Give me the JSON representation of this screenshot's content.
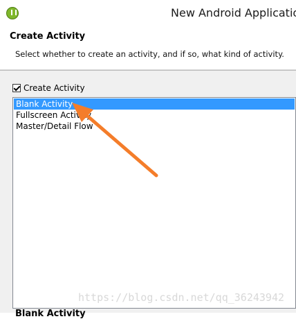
{
  "window": {
    "title": "New Android Application",
    "app_icon": "android-adt-icon"
  },
  "header": {
    "title": "Create Activity",
    "description": "Select whether to create an activity, and if so, what kind of activity."
  },
  "create_activity_checkbox": {
    "label": "Create Activity",
    "checked": true
  },
  "activity_list": {
    "items": [
      {
        "label": "Blank Activity",
        "selected": true
      },
      {
        "label": "Fullscreen Activity",
        "selected": false
      },
      {
        "label": "Master/Detail Flow",
        "selected": false
      }
    ]
  },
  "watermark": "https://blog.csdn.net/qq_36243942",
  "bottom_section": {
    "title": "Blank Activity"
  },
  "annotation": {
    "type": "arrow",
    "color": "#f47d2a"
  },
  "colors": {
    "selection": "#3399ff",
    "arrow": "#f47d2a"
  }
}
